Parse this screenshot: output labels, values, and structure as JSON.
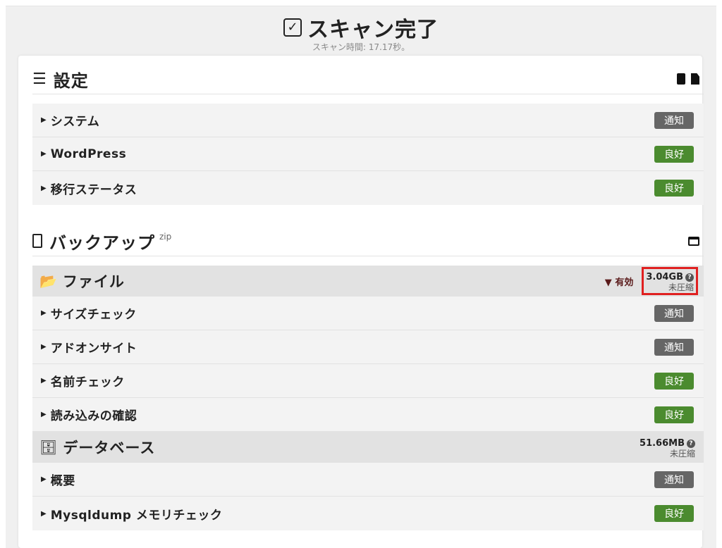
{
  "header": {
    "title": "スキャン完了",
    "subtitle": "スキャン時間: 17.17秒。"
  },
  "colors": {
    "notice": "#666666",
    "good": "#4b8b2f",
    "highlight": "#e02020"
  },
  "settings": {
    "title": "設定",
    "icons": [
      "chip-icon",
      "file-icon"
    ],
    "items": [
      {
        "label": "システム",
        "status": "通知",
        "kind": "notice"
      },
      {
        "label": "WordPress",
        "status": "良好",
        "kind": "good"
      },
      {
        "label": "移行ステータス",
        "status": "良好",
        "kind": "good"
      }
    ]
  },
  "backup": {
    "title": "バックアップ",
    "format": "zip",
    "files": {
      "title": "ファイル",
      "filter": "有効",
      "size": "3.04GB",
      "size_note": "未圧縮",
      "items": [
        {
          "label": "サイズチェック",
          "status": "通知",
          "kind": "notice"
        },
        {
          "label": "アドオンサイト",
          "status": "通知",
          "kind": "notice"
        },
        {
          "label": "名前チェック",
          "status": "良好",
          "kind": "good"
        },
        {
          "label": "読み込みの確認",
          "status": "良好",
          "kind": "good"
        }
      ]
    },
    "database": {
      "title": "データベース",
      "size": "51.66MB",
      "size_note": "未圧縮",
      "items": [
        {
          "label": "概要",
          "status": "通知",
          "kind": "notice"
        },
        {
          "label": "Mysqldump メモリチェック",
          "status": "良好",
          "kind": "good"
        }
      ]
    }
  }
}
